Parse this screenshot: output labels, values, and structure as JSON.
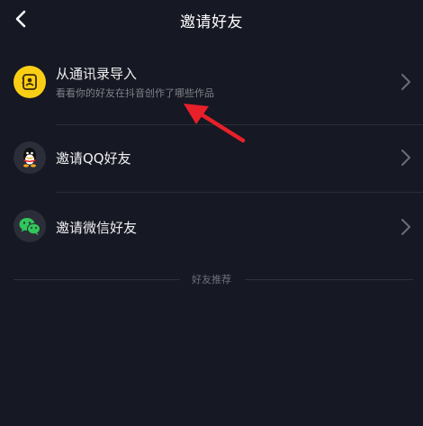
{
  "header": {
    "title": "邀请好友",
    "back_icon": "chevron-left-icon"
  },
  "items": [
    {
      "label": "从通讯录导入",
      "sublabel": "看看你的好友在抖音创作了哪些作品",
      "icon": "contacts-icon",
      "color": "#FACE15"
    },
    {
      "label": "邀请QQ好友",
      "icon": "qq-penguin-icon",
      "color": "#2B2D38"
    },
    {
      "label": "邀请微信好友",
      "icon": "wechat-icon",
      "color": "#2B2D38"
    }
  ],
  "recommend": {
    "label": "好友推荐"
  },
  "annotation": {
    "icon": "red-arrow-icon",
    "color": "#E8202A"
  }
}
